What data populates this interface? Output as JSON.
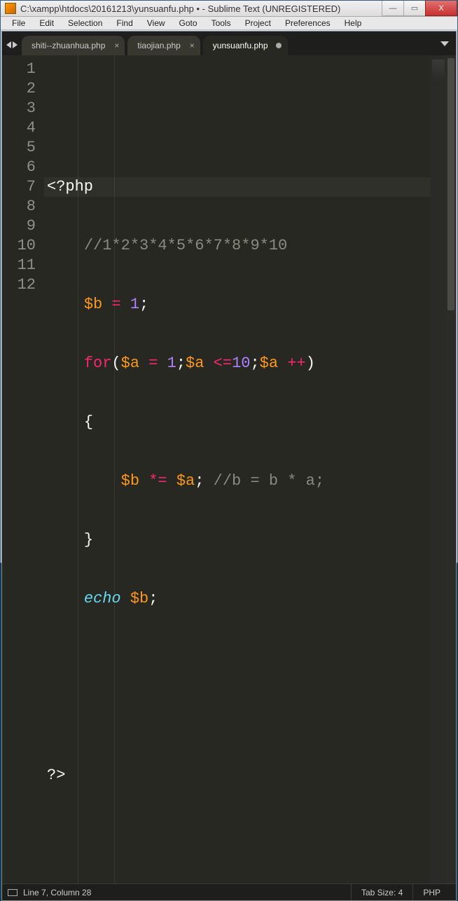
{
  "titlebar": {
    "path": "C:\\xampp\\htdocs\\20161213\\yunsuanfu.php • - Sublime Text (UNREGISTERED)"
  },
  "window_controls": {
    "minimize": "—",
    "maximize": "▭",
    "close": "X"
  },
  "menu": {
    "items": [
      "File",
      "Edit",
      "Selection",
      "Find",
      "View",
      "Goto",
      "Tools",
      "Project",
      "Preferences",
      "Help"
    ]
  },
  "tabs": [
    {
      "label": "shiti--zhuanhua.php",
      "dirty": false,
      "active": false,
      "closeable": true
    },
    {
      "label": "tiaojian.php",
      "dirty": false,
      "active": false,
      "closeable": true
    },
    {
      "label": "yunsuanfu.php",
      "dirty": true,
      "active": true,
      "closeable": false
    }
  ],
  "editor": {
    "highlighted_line": 7,
    "line_count": 12,
    "lines": {
      "l1": {
        "raw": "<?php"
      },
      "l2": {
        "comment": "//1*2*3*4*5*6*7*8*9*10"
      },
      "l3": {
        "var": "$b",
        "op": "=",
        "num": "1",
        "semi": ";"
      },
      "l4": {
        "kw": "for",
        "open": "(",
        "var1": "$a",
        "op1": "=",
        "num1": "1",
        "semi1": ";",
        "var2": "$a",
        "op2": "<=",
        "num2": "10",
        "semi2": ";",
        "var3": "$a",
        "op3": "++",
        "close": ")"
      },
      "l5": {
        "brace": "{"
      },
      "l6": {
        "var": "$b",
        "op": "*=",
        "var2": "$a",
        "semi": ";",
        "comment": "//b = b * a;"
      },
      "l7": {
        "brace": "}"
      },
      "l8": {
        "kw": "echo",
        "sp": " ",
        "var": "$b",
        "semi": ";"
      },
      "l11": {
        "close": "?>"
      }
    }
  },
  "statusbar": {
    "cursor": "Line 7, Column 28",
    "tab_size": "Tab Size: 4",
    "syntax": "PHP"
  }
}
